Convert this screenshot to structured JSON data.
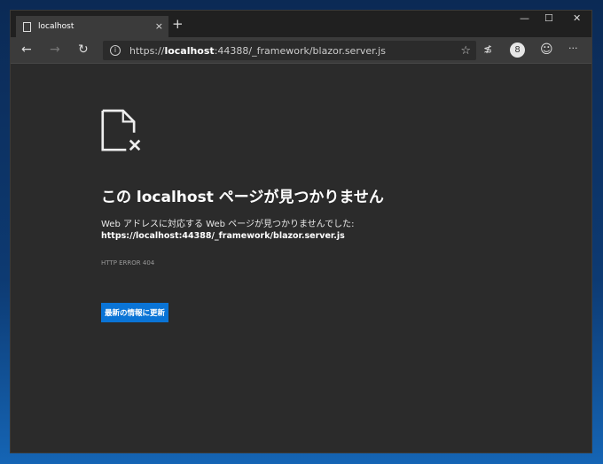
{
  "tab": {
    "title": "localhost",
    "close": "×",
    "new": "+"
  },
  "window": {
    "minimize": "—",
    "maximize": "☐",
    "close": "✕"
  },
  "toolbar": {
    "back": "←",
    "forward": "→",
    "refresh": "↻",
    "url_prefix": "https://",
    "url_host": "localhost",
    "url_rest": ":44388/_framework/blazor.server.js",
    "favorite": "☆",
    "favorites": "≴",
    "profile": "8",
    "feedback": "☺",
    "more": "···"
  },
  "page": {
    "title": "この localhost ページが見つかりません",
    "desc": "Web アドレスに対応する Web ページが見つかりませんでした:",
    "url": "https://localhost:44388/_framework/blazor.server.js",
    "error_code": "HTTP ERROR 404",
    "refresh_button": "最新の情報に更新"
  }
}
